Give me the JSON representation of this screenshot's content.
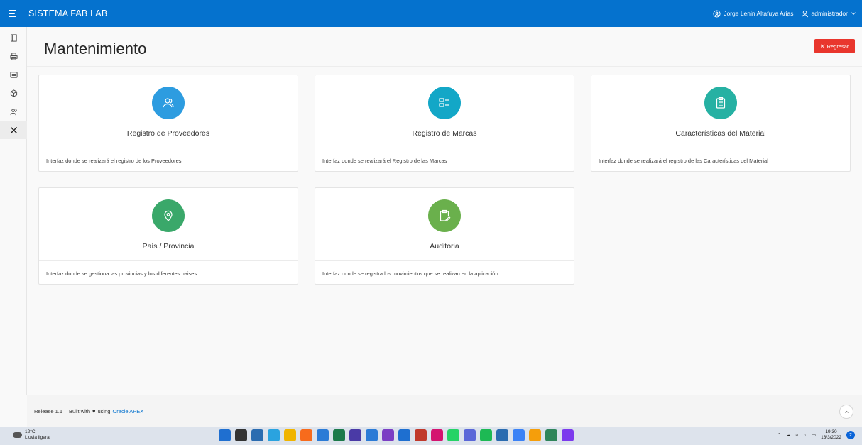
{
  "header": {
    "app_title": "SISTEMA FAB LAB",
    "user_full_name": "Jorge Lenin Altafuya Arias",
    "user_role": "administrador",
    "color": "#0572ce"
  },
  "sidebar": {
    "items": [
      {
        "icon": "file-icon"
      },
      {
        "icon": "printer-icon"
      },
      {
        "icon": "list-box-icon"
      },
      {
        "icon": "cube-icon"
      },
      {
        "icon": "users-icon"
      },
      {
        "icon": "tools-icon"
      }
    ]
  },
  "page": {
    "title": "Mantenimiento",
    "back_button": "Regresar",
    "back_color": "#e9362d"
  },
  "cards": [
    {
      "title": "Registro de Proveedores",
      "description": "Interfaz donde se realizará el registro de los Proveedores",
      "icon": "users-icon",
      "color": "#2d9ce0"
    },
    {
      "title": "Registro de Marcas",
      "description": "Interfaz donde se realizará el Registro de las Marcas",
      "icon": "list-icon",
      "color": "#13a7c7"
    },
    {
      "title": "Características del Material",
      "description": "Interfaz donde se realizará el registro de las Características del Material",
      "icon": "clipboard-list-icon",
      "color": "#26b1a3"
    },
    {
      "title": "País / Provincia",
      "description": "Interfaz donde se gestiona las provincias y los diferentes paises.",
      "icon": "map-pin-icon",
      "color": "#3aa86a"
    },
    {
      "title": "Auditoria",
      "description": "Interfaz donde se registra los movimientos que se realizan en la aplicación.",
      "icon": "clipboard-edit-icon",
      "color": "#6ab04c"
    }
  ],
  "footer": {
    "release": "Release 1.1",
    "built_prefix": "Built with",
    "built_using": "using",
    "link": "Oracle APEX"
  },
  "taskbar": {
    "temperature": "12°C",
    "weather": "Lluvia ligera",
    "time": "19:30",
    "date": "13/3/2022",
    "notifications": "2",
    "apps": [
      "#1f6fd0",
      "#333333",
      "#2b6cb0",
      "#2aa3df",
      "#f0b400",
      "#f76b1c",
      "#2b7bd6",
      "#1c7a4a",
      "#4a3aa6",
      "#2b7bd6",
      "#7b3fc4",
      "#1e6fd0",
      "#c0392b",
      "#d4146f",
      "#25d366",
      "#5a67d8",
      "#1db954",
      "#2b6cb0",
      "#3b82f6",
      "#f59e0b",
      "#2f855a",
      "#7c3aed"
    ]
  }
}
